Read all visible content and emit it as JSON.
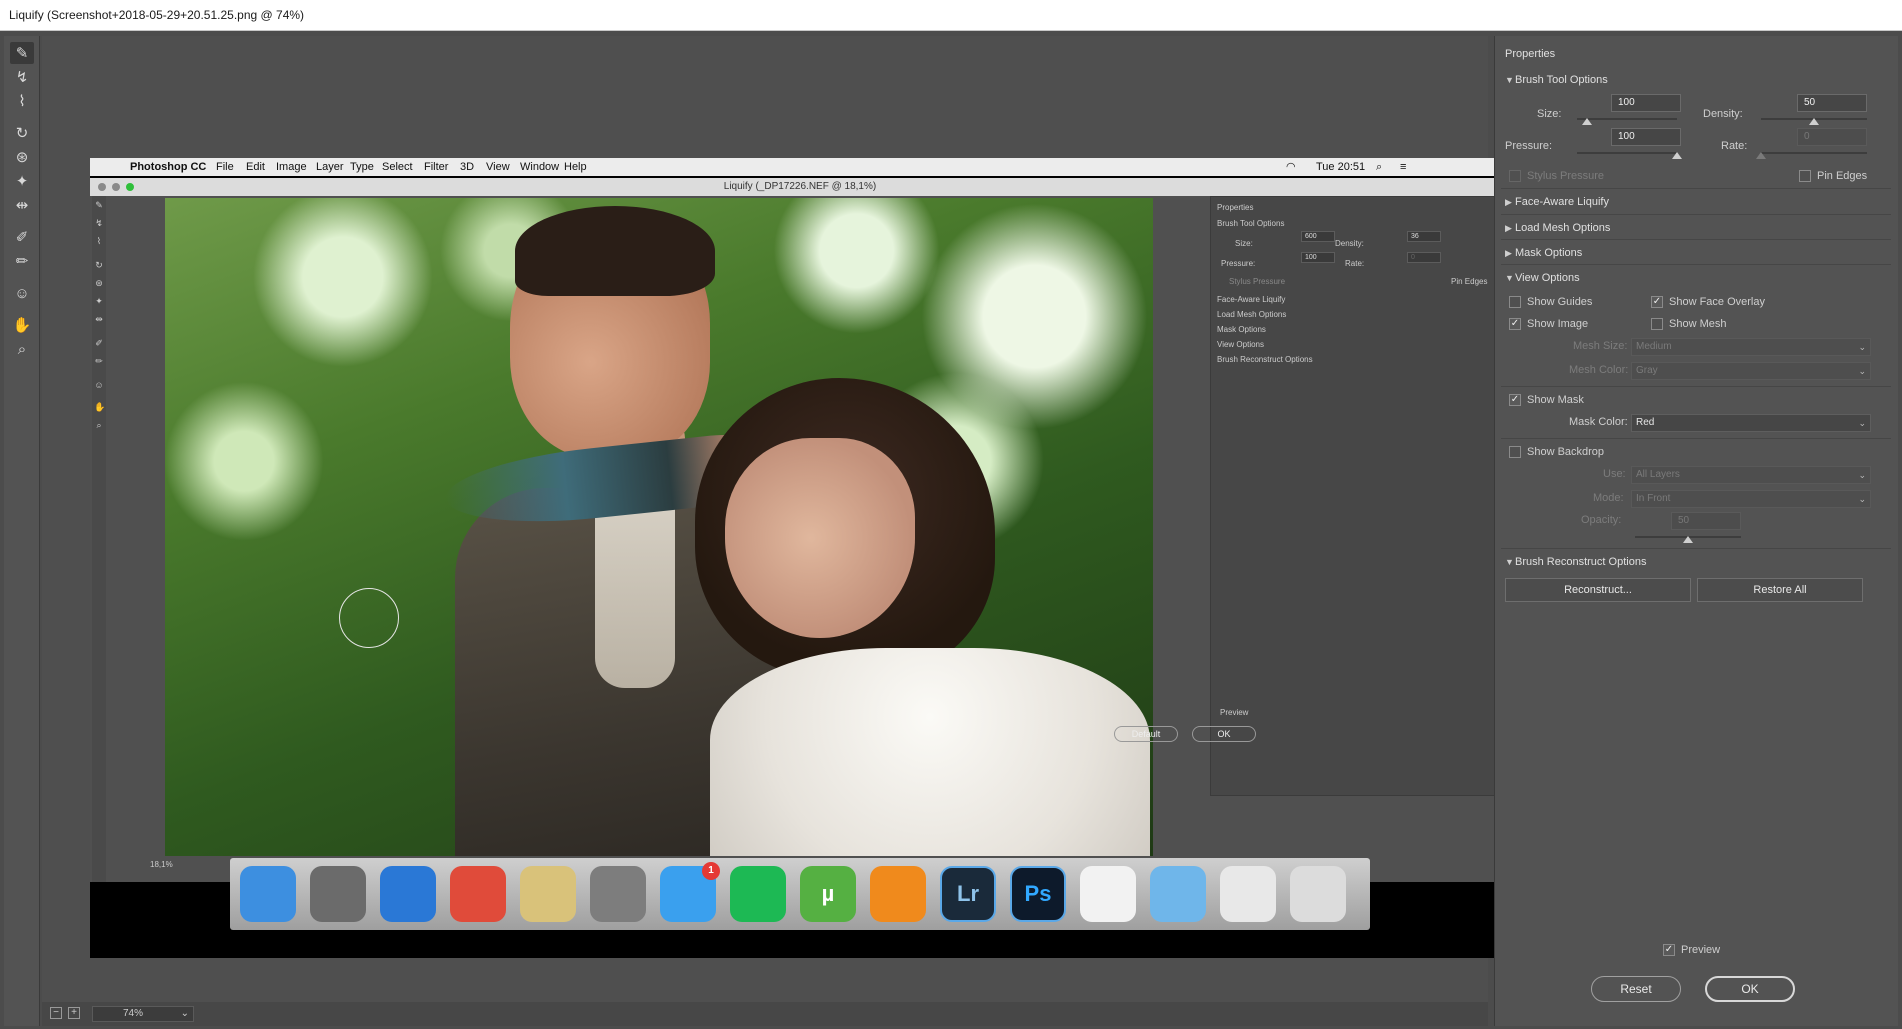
{
  "window": {
    "title": "Liquify (Screenshot+2018-05-29+20.51.25.png @ 74%)"
  },
  "tools": [
    {
      "icon": "forward-warp-icon",
      "glyph": "✎"
    },
    {
      "icon": "reconstruct-icon",
      "glyph": "↯"
    },
    {
      "icon": "smooth-icon",
      "glyph": "⌇"
    },
    {
      "icon": "twirl-icon",
      "glyph": "↻"
    },
    {
      "icon": "pucker-icon",
      "glyph": "⊛"
    },
    {
      "icon": "bloat-icon",
      "glyph": "✦"
    },
    {
      "icon": "push-left-icon",
      "glyph": "⇹"
    },
    {
      "icon": "freeze-mask-icon",
      "glyph": "✐"
    },
    {
      "icon": "thaw-mask-icon",
      "glyph": "✏"
    },
    {
      "icon": "face-tool-icon",
      "glyph": "☺"
    },
    {
      "icon": "hand-icon",
      "glyph": "✋"
    },
    {
      "icon": "zoom-icon",
      "glyph": "⌕"
    }
  ],
  "zoom": {
    "value": "74%"
  },
  "mac": {
    "app": "Photoshop CC",
    "menus": [
      "File",
      "Edit",
      "Image",
      "Layer",
      "Type",
      "Select",
      "Filter",
      "3D",
      "View",
      "Window",
      "Help"
    ],
    "clock": "Tue 20:51",
    "window_title": "Liquify (_DP17226.NEF @ 18,1%)",
    "zoom": "18,1%",
    "props": {
      "title": "Properties",
      "brush_tool_options": "Brush Tool Options",
      "size_label": "Size:",
      "size": "600",
      "density_label": "Density:",
      "density": "36",
      "pressure_label": "Pressure:",
      "pressure": "100",
      "rate_label": "Rate:",
      "rate": "0",
      "stylus": "Stylus Pressure",
      "pin": "Pin Edges",
      "sections": [
        "Face-Aware Liquify",
        "Load Mesh Options",
        "Mask Options",
        "View Options",
        "Brush Reconstruct Options"
      ],
      "preview": "Preview",
      "default_btn": "Default",
      "ok_btn": "OK"
    },
    "dock": [
      {
        "name": "finder",
        "label": "",
        "color": "#3d8fe0"
      },
      {
        "name": "launchpad",
        "label": "",
        "color": "#6b6b6b"
      },
      {
        "name": "safari",
        "label": "",
        "color": "#2a78d6"
      },
      {
        "name": "chrome",
        "label": "",
        "color": "#e04b3a"
      },
      {
        "name": "preview",
        "label": "",
        "color": "#d9c27a"
      },
      {
        "name": "system-preferences",
        "label": "",
        "color": "#7d7d7d"
      },
      {
        "name": "app-store",
        "label": "",
        "color": "#3aa0ee",
        "badge": "1"
      },
      {
        "name": "spotify",
        "label": "",
        "color": "#1db954"
      },
      {
        "name": "utorrent",
        "label": "µ",
        "color": "#55b042"
      },
      {
        "name": "vlc",
        "label": "",
        "color": "#f08a1c"
      },
      {
        "name": "lightroom",
        "label": "Lr",
        "color": "#1a2a3a"
      },
      {
        "name": "photoshop",
        "label": "Ps",
        "color": "#0d1a2b"
      },
      {
        "name": "document",
        "label": "",
        "color": "#f2f2f2"
      },
      {
        "name": "folder",
        "label": "",
        "color": "#6fb6ea"
      },
      {
        "name": "screenshot",
        "label": "",
        "color": "#e8e8e8"
      },
      {
        "name": "trash",
        "label": "",
        "color": "#dcdcdc"
      }
    ]
  },
  "panel": {
    "title": "Properties",
    "brush_tool_options": "Brush Tool Options",
    "size_label": "Size:",
    "size": "100",
    "size_level": 0.1,
    "density_label": "Density:",
    "density": "50",
    "density_level": 0.5,
    "pressure_label": "Pressure:",
    "pressure": "100",
    "pressure_level": 1.0,
    "rate_label": "Rate:",
    "rate": "0",
    "rate_level": 0.0,
    "stylus_pressure": "Stylus Pressure",
    "pin_edges": "Pin Edges",
    "face_aware": "Face-Aware Liquify",
    "load_mesh": "Load Mesh Options",
    "mask_options": "Mask Options",
    "view_options": "View Options",
    "show_guides": "Show Guides",
    "show_face_overlay": "Show Face Overlay",
    "show_image": "Show Image",
    "show_mesh": "Show Mesh",
    "mesh_size_label": "Mesh Size:",
    "mesh_size": "Medium",
    "mesh_color_label": "Mesh Color:",
    "mesh_color": "Gray",
    "show_mask": "Show Mask",
    "mask_color_label": "Mask Color:",
    "mask_color": "Red",
    "show_backdrop": "Show Backdrop",
    "use_label": "Use:",
    "use": "All Layers",
    "mode_label": "Mode:",
    "mode": "In Front",
    "opacity_label": "Opacity:",
    "opacity": "50",
    "opacity_level": 0.5,
    "brush_reconstruct": "Brush Reconstruct Options",
    "reconstruct_btn": "Reconstruct...",
    "restore_all_btn": "Restore All",
    "preview": "Preview",
    "reset_btn": "Reset",
    "ok_btn": "OK"
  }
}
